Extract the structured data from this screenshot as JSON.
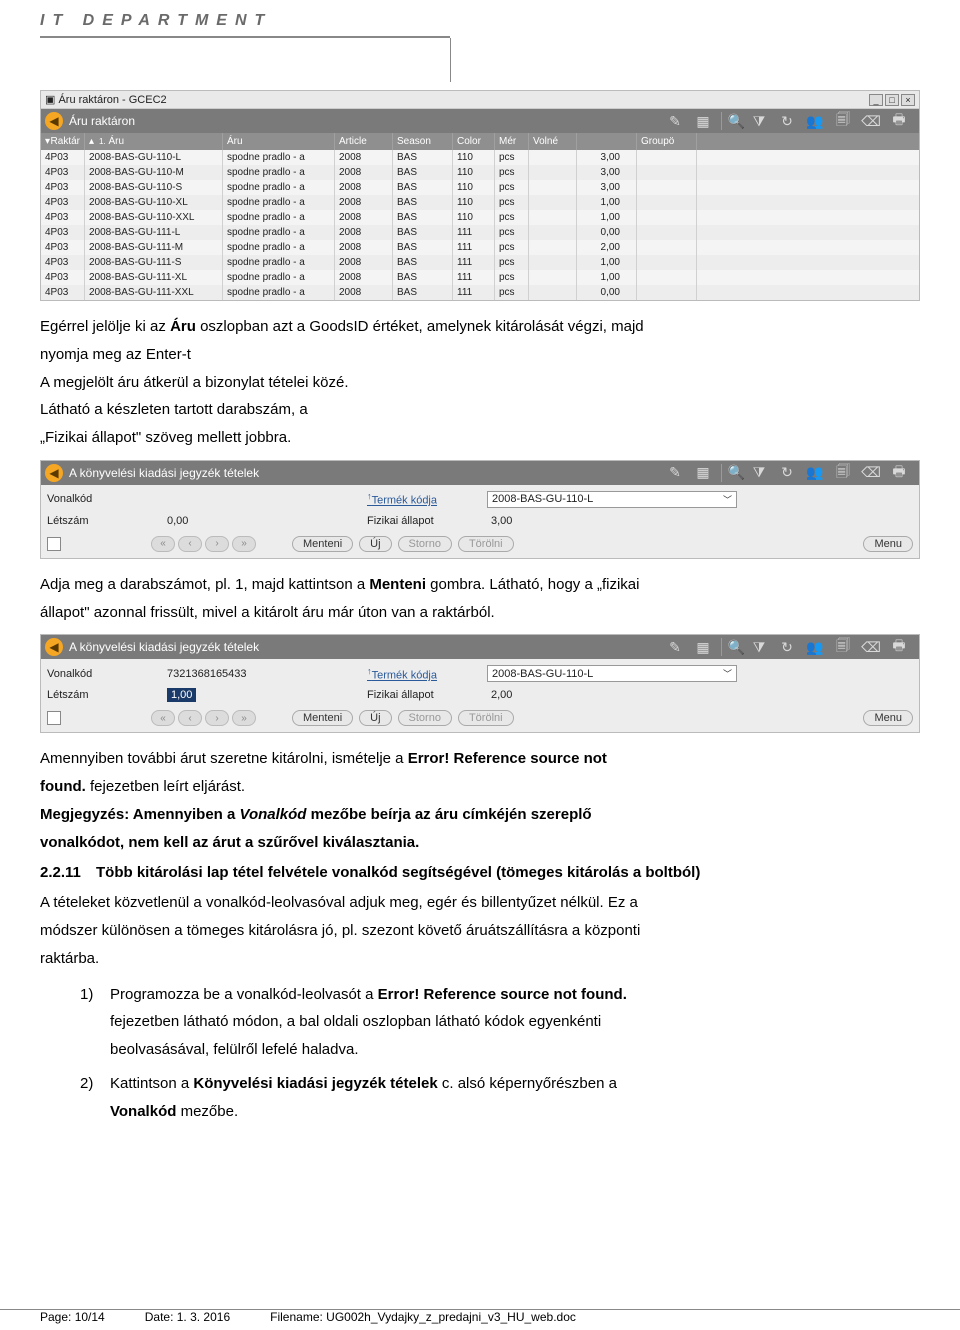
{
  "header": {
    "title": "IT DEPARTMENT"
  },
  "shot1": {
    "window_title": "Áru raktáron - GCEC2",
    "panel_title": "Áru raktáron",
    "columns": [
      "Raktár",
      "Áru",
      "Áru",
      "Article",
      "Season",
      "Color",
      "Mér",
      "Volné",
      "",
      "Groupö"
    ],
    "rows": [
      {
        "rak": "4P03",
        "aru": "2008-BAS-GU-110-L",
        "aru2": "spodne pradlo - a",
        "art": "2008",
        "sea": "BAS",
        "col": "110",
        "mer": "pcs",
        "qty": "3,00"
      },
      {
        "rak": "4P03",
        "aru": "2008-BAS-GU-110-M",
        "aru2": "spodne pradlo - a",
        "art": "2008",
        "sea": "BAS",
        "col": "110",
        "mer": "pcs",
        "qty": "3,00"
      },
      {
        "rak": "4P03",
        "aru": "2008-BAS-GU-110-S",
        "aru2": "spodne pradlo - a",
        "art": "2008",
        "sea": "BAS",
        "col": "110",
        "mer": "pcs",
        "qty": "3,00"
      },
      {
        "rak": "4P03",
        "aru": "2008-BAS-GU-110-XL",
        "aru2": "spodne pradlo - a",
        "art": "2008",
        "sea": "BAS",
        "col": "110",
        "mer": "pcs",
        "qty": "1,00"
      },
      {
        "rak": "4P03",
        "aru": "2008-BAS-GU-110-XXL",
        "aru2": "spodne pradlo - a",
        "art": "2008",
        "sea": "BAS",
        "col": "110",
        "mer": "pcs",
        "qty": "1,00"
      },
      {
        "rak": "4P03",
        "aru": "2008-BAS-GU-111-L",
        "aru2": "spodne pradlo - a",
        "art": "2008",
        "sea": "BAS",
        "col": "111",
        "mer": "pcs",
        "qty": "0,00"
      },
      {
        "rak": "4P03",
        "aru": "2008-BAS-GU-111-M",
        "aru2": "spodne pradlo - a",
        "art": "2008",
        "sea": "BAS",
        "col": "111",
        "mer": "pcs",
        "qty": "2,00"
      },
      {
        "rak": "4P03",
        "aru": "2008-BAS-GU-111-S",
        "aru2": "spodne pradlo - a",
        "art": "2008",
        "sea": "BAS",
        "col": "111",
        "mer": "pcs",
        "qty": "1,00"
      },
      {
        "rak": "4P03",
        "aru": "2008-BAS-GU-111-XL",
        "aru2": "spodne pradlo - a",
        "art": "2008",
        "sea": "BAS",
        "col": "111",
        "mer": "pcs",
        "qty": "1,00"
      },
      {
        "rak": "4P03",
        "aru": "2008-BAS-GU-111-XXL",
        "aru2": "spodne pradlo - a",
        "art": "2008",
        "sea": "BAS",
        "col": "111",
        "mer": "pcs",
        "qty": "0,00"
      }
    ]
  },
  "para1": {
    "l1a": "Egérrel jelölje ki az ",
    "l1b": "Áru",
    "l1c": " oszlopban azt a GoodsID értéket, amelynek kitárolását végzi, majd",
    "l2": "nyomja meg az Enter-t",
    "l3": "A megjelölt áru átkerül a bizonylat tételei közé.",
    "l4": "Látható a készleten tartott darabszám, a",
    "l5": "„Fizikai állapot\" szöveg mellett jobbra."
  },
  "shot2": {
    "panel_title": "A könyvelési kiadási jegyzék tételek",
    "vonalkod_lbl": "Vonalkód",
    "vonalkod_val": "",
    "letszam_lbl": "Létszám",
    "letszam_val": "0,00",
    "termek_lbl": "Termék kódja",
    "termek_val": "2008-BAS-GU-110-L",
    "fizikai_lbl": "Fizikai állapot",
    "fizikai_val": "3,00",
    "btns": {
      "menteni": "Menteni",
      "uj": "Új",
      "storno": "Storno",
      "torolni": "Törölni",
      "menu": "Menu"
    }
  },
  "para2": {
    "l1a": "Adja meg a darabszámot, pl. 1, majd kattintson a ",
    "l1b": "Menteni",
    "l1c": " gombra. Látható, hogy a „fizikai",
    "l2": "állapot\" azonnal frissült, mivel a kitárolt áru már úton van a raktárból."
  },
  "shot3": {
    "panel_title": "A könyvelési kiadási jegyzék tételek",
    "vonalkod_lbl": "Vonalkód",
    "vonalkod_val": "7321368165433",
    "letszam_lbl": "Létszám",
    "letszam_val": "1,00",
    "termek_lbl": "Termék kódja",
    "termek_val": "2008-BAS-GU-110-L",
    "fizikai_lbl": "Fizikai állapot",
    "fizikai_val": "2,00",
    "btns": {
      "menteni": "Menteni",
      "uj": "Új",
      "storno": "Storno",
      "torolni": "Törölni",
      "menu": "Menu"
    }
  },
  "para3": {
    "l1": "Amennyiben további árut szeretne kitárolni, ismételje a ",
    "l1b": "Error! Reference source not",
    "l2": "found.",
    "l2a": " fejezetben leírt eljárást.",
    "l3": "Megjegyzés: Amennyiben a ",
    "l3i": "Vonalkód",
    "l3b": " mezőbe beírja az áru címkéjén szereplő",
    "l4": "vonalkódot, nem kell az árut a szűrővel kiválasztania."
  },
  "sect": {
    "num": "2.2.11",
    "title": "Több kitárolási lap tétel felvétele vonalkód segítségével (tömeges kitárolás a boltból)"
  },
  "para4": {
    "l1": "A tételeket közvetlenül a vonalkód-leolvasóval adjuk meg, egér és billentyűzet nélkül. Ez a",
    "l2": "módszer különösen a tömeges kitárolásra jó, pl. szezont követő áruátszállításra a központi",
    "l3": "raktárba."
  },
  "list": {
    "i1n": "1)",
    "i1a": "Programozza be a vonalkód-leolvasót a ",
    "i1b": "Error! Reference source not found.",
    "i1c": "fejezetben látható módon, a bal oldali oszlopban látható kódok egyenkénti",
    "i1d": "beolvasásával, felülről lefelé haladva.",
    "i2n": "2)",
    "i2a": "Kattintson a ",
    "i2b": "Könyvelési kiadási jegyzék tételek",
    "i2c": " c. alsó képernyőrészben a",
    "i2d": "Vonalkód",
    "i2e": " mezőbe."
  },
  "footer": {
    "page": "Page: 10/14",
    "date": "Date: 1. 3. 2016",
    "file": "Filename: UG002h_Vydajky_z_predajni_v3_HU_web.doc"
  }
}
